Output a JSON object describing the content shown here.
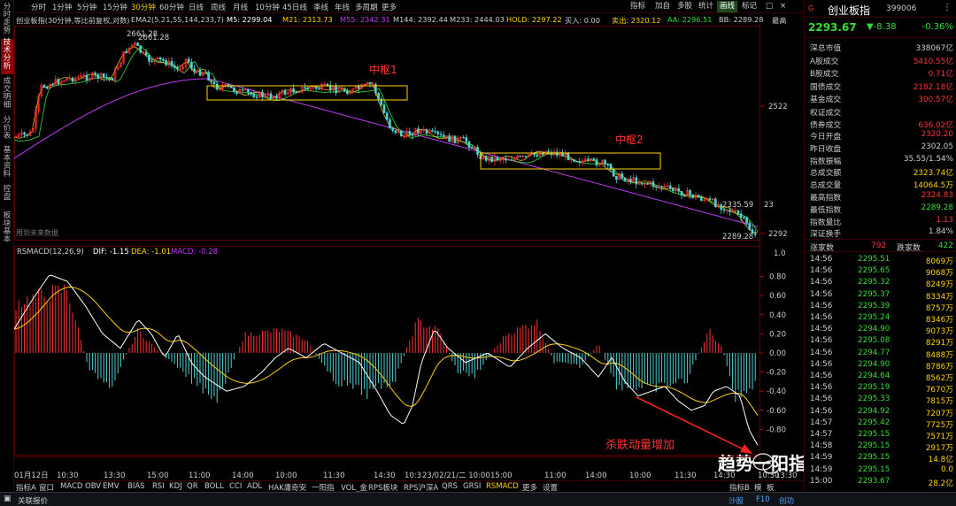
{
  "left_tabs": [
    "分时走势",
    "技术分析",
    "成交明细",
    "分价表",
    "基本资料",
    "控盘",
    "板块基本"
  ],
  "period_tabs": [
    "分时",
    "1分钟",
    "5分钟",
    "15分钟",
    "30分钟",
    "60分钟",
    "日线",
    "周线",
    "月线",
    "10分钟",
    "45日线",
    "季线",
    "年线",
    "多周期",
    "更多"
  ],
  "toolbar_buttons": [
    "指标",
    "加自",
    "多股",
    "统计",
    "画线",
    "标记"
  ],
  "info": {
    "title": "创业板指(30分钟,等比前复权,对数)",
    "ema": "EMA2(5,21,55,144,233,7)",
    "m5": "M5: 2299.04",
    "m21": "M21: 2313.73",
    "m55": "M55: 2342.31",
    "m144": "M144: 2392.44",
    "m233": "M233: 2444.03",
    "hold": "HOLD: 2297.22",
    "buy": "买入: 0.00",
    "sell": "卖出: 2320.12",
    "aa": "AA: 2296.51",
    "hl": "BB: 2289.28",
    "more": "最高"
  },
  "annotations": {
    "zs1": "中枢1",
    "zs2": "中枢2",
    "kill": "杀跌动量增加",
    "high": "2661.28",
    "high2": "2661.28",
    "price_a": "2335.59",
    "price_a2": "23",
    "low": "2289.28",
    "future": "用到未来数据"
  },
  "price_axis": [
    "2522",
    "2292"
  ],
  "macd": {
    "title": "RSMACD(12,26,9)",
    "dif": "DIF: -1.15",
    "dea": "DEA: -1.01",
    "macd": "MACD: -0.28",
    "scale_top": "1.0",
    "axis": [
      "0.80",
      "0.60",
      "0.40",
      "0.20",
      "0.00",
      "-0.20",
      "-0.40",
      "-0.60",
      "-0.80"
    ]
  },
  "time_axis": [
    "01月12日",
    "10:30",
    "13:30",
    "15:00",
    "11:00",
    "14:00",
    "10:00",
    "11:30",
    "14:30",
    "10:3",
    "23/02/21/二 10:00",
    "15:00",
    "11:00",
    "14:00",
    "10:00",
    "11:30",
    "14:30",
    "10:30",
    "13:30"
  ],
  "indicators": [
    "指标A",
    "窗口",
    "MACD",
    "OBV",
    "EMV",
    "BIAS",
    "RSI",
    "KDJ",
    "QR",
    "BOLL",
    "CCI",
    "ADL",
    "HAK庸奇安",
    "一阳指",
    "VOL_金",
    "RPS板块",
    "RPS沪深A",
    "QRS",
    "GRSI",
    "RSMACD",
    "更多",
    "设置"
  ],
  "ind_right": [
    "指标B",
    "模",
    "板"
  ],
  "watermark": "趋势一阳指",
  "status": {
    "left": "关联报价",
    "right": [
      "沙股",
      "F10",
      "创功"
    ]
  },
  "quote": {
    "g": "G",
    "name": "创业板指",
    "code": "399006",
    "price": "2293.67",
    "change": "▼-8.38",
    "pct": "-0.36%"
  },
  "stats1": [
    {
      "k": "深总市值",
      "v": "338067亿",
      "c": "#cccccc"
    },
    {
      "k": "A股成交",
      "v": "5410.55亿",
      "c": "#ff3333"
    },
    {
      "k": "B股成交",
      "v": "0.71亿",
      "c": "#ff3333"
    },
    {
      "k": "国债成交",
      "v": "2182.18亿",
      "c": "#ff3333"
    },
    {
      "k": "基金成交",
      "v": "300.57亿",
      "c": "#ff3333"
    },
    {
      "k": "权证成交",
      "v": "",
      "c": "#ff3333"
    },
    {
      "k": "债券成交",
      "v": "636.02亿",
      "c": "#ff3333"
    }
  ],
  "stats2": [
    {
      "k": "今日开盘",
      "v": "2320.20",
      "c": "#ff3333"
    },
    {
      "k": "昨日收盘",
      "v": "2302.05",
      "c": "#cccccc"
    },
    {
      "k": "指数振幅",
      "v": "35.55/1.54%",
      "c": "#cccccc"
    },
    {
      "k": "总成交额",
      "v": "2323.74亿",
      "c": "#ffd200"
    },
    {
      "k": "总成交量",
      "v": "14064.5万",
      "c": "#ffd200"
    },
    {
      "k": "最高指数",
      "v": "2324.83",
      "c": "#ff3333"
    },
    {
      "k": "最低指数",
      "v": "2289.28",
      "c": "#33dd33"
    },
    {
      "k": "指数量比",
      "v": "1.13",
      "c": "#ff3333"
    },
    {
      "k": "深证换手",
      "v": "1.84%",
      "c": "#cccccc"
    }
  ],
  "updown": {
    "up_label": "涨家数",
    "up": "792",
    "down_label": "跌家数",
    "down": "422"
  },
  "ticks": [
    [
      "14:56",
      "2295.51",
      "8069万"
    ],
    [
      "14:56",
      "2295.65",
      "9068万"
    ],
    [
      "14:56",
      "2295.32",
      "8249万"
    ],
    [
      "14:56",
      "2295.37",
      "8334万"
    ],
    [
      "14:56",
      "2295.39",
      "8757万"
    ],
    [
      "14:56",
      "2295.24",
      "8346万"
    ],
    [
      "14:56",
      "2294.90",
      "9073万"
    ],
    [
      "14:56",
      "2295.08",
      "8291万"
    ],
    [
      "14:56",
      "2294.77",
      "8488万"
    ],
    [
      "14:56",
      "2294.90",
      "8786万"
    ],
    [
      "14:56",
      "2294.64",
      "8562万"
    ],
    [
      "14:56",
      "2295.19",
      "7670万"
    ],
    [
      "14:56",
      "2295.33",
      "7815万"
    ],
    [
      "14:56",
      "2294.92",
      "7207万"
    ],
    [
      "14:57",
      "2295.42",
      "7725万"
    ],
    [
      "14:57",
      "2295.15",
      "7571万"
    ],
    [
      "14:58",
      "2295.15",
      "2917万"
    ],
    [
      "14:59",
      "2295.15",
      "14.8亿"
    ],
    [
      "14:59",
      "2295.15",
      "0.0"
    ],
    [
      "15:00",
      "2293.67",
      "28.2亿"
    ]
  ],
  "colors": {
    "up": "#ff3333",
    "down": "#33dd33",
    "yellow": "#ffd200",
    "cyan": "#4fd2d2",
    "purple": "#c03cf0",
    "green_line": "#2ecc2e"
  }
}
